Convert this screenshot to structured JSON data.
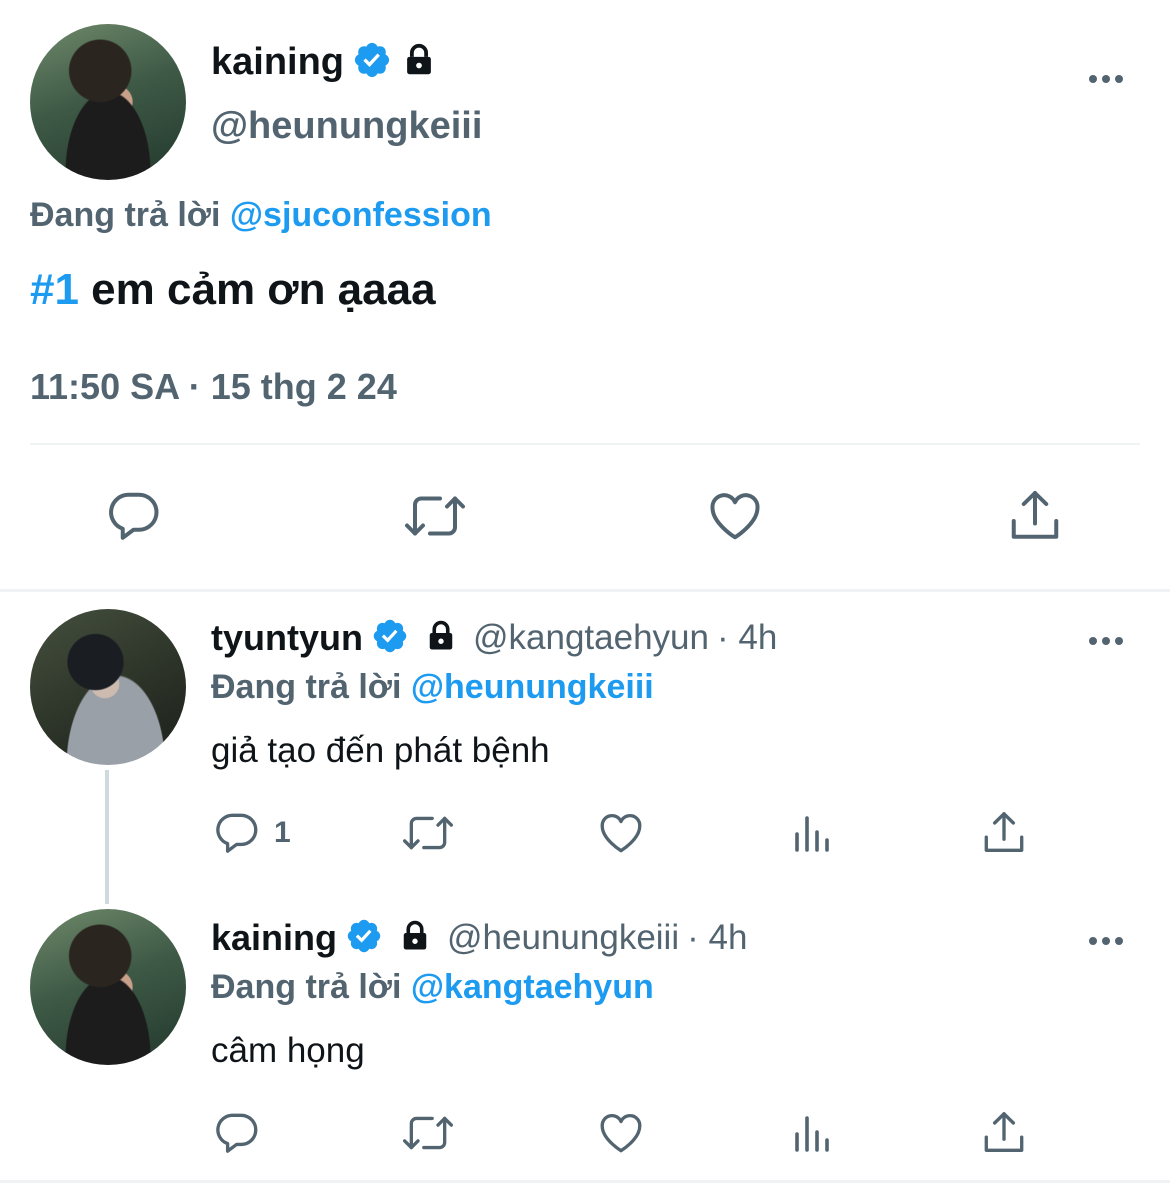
{
  "main_tweet": {
    "display_name": "kaining",
    "handle": "@heunungkeiii",
    "reply_prefix": "Đang trả lời",
    "reply_to": "@sjuconfession",
    "hashtag": "#1",
    "text": " em cảm ơn ạaaa",
    "timestamp": "11:50 SA · 15 thg 2 24"
  },
  "replies": [
    {
      "display_name": "tyuntyun",
      "handle": "@kangtaehyun",
      "time": "· 4h",
      "reply_prefix": "Đang trả lời",
      "reply_to": "@heunungkeiii",
      "text": "giả tạo đến phát bệnh",
      "reply_count": "1"
    },
    {
      "display_name": "kaining",
      "handle": "@heunungkeiii",
      "time": "· 4h",
      "reply_prefix": "Đang trả lời",
      "reply_to": "@kangtaehyun",
      "text": "câm họng",
      "reply_count": ""
    }
  ],
  "icons": {
    "verified": "verified-badge-icon",
    "lock": "lock-icon",
    "more": "more-icon",
    "reply": "reply-icon",
    "retweet": "retweet-icon",
    "like": "heart-icon",
    "views": "views-icon",
    "share": "share-icon"
  },
  "colors": {
    "accent": "#1d9bf0",
    "text": "#0f1419",
    "muted": "#536471",
    "divider": "#eff3f4"
  }
}
